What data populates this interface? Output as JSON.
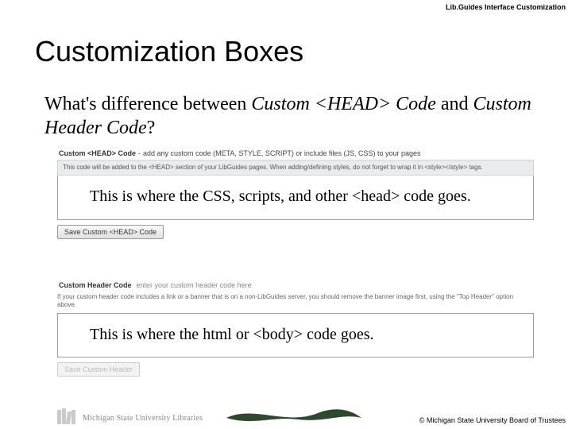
{
  "header": {
    "label": "Lib.Guides Interface Customization"
  },
  "title": "Customization Boxes",
  "question": {
    "prefix": "What's difference between ",
    "italic1": "Custom <HEAD> Code",
    "mid": " and ",
    "italic2": "Custom Header Code",
    "suffix": "?"
  },
  "panel1": {
    "title_bold": "Custom <HEAD> Code",
    "title_rest": "add any custom code (META, STYLE, SCRIPT) or include files (JS, CSS) to your pages",
    "helper": "This code will be added to the <HEAD> section of your LibGuides pages. When adding/defining styles, do not forget to wrap it in <style></style> tags.",
    "textarea": "This is where the CSS, scripts, and other <head> code goes.",
    "button": "Save Custom <HEAD> Code"
  },
  "panel2": {
    "title_bold": "Custom Header Code",
    "title_hint": "enter your custom header code here",
    "helper": "If your custom header code includes a link or a banner that is on a non-LibGuides server, you should remove the banner image first, using the \"Top Header\" option above.",
    "textarea": "This is where the html or <body> code goes.",
    "button": "Save Custom Header"
  },
  "footer": {
    "logo_text": "Michigan State University Libraries",
    "copyright": "© Michigan State University Board of Trustees"
  }
}
